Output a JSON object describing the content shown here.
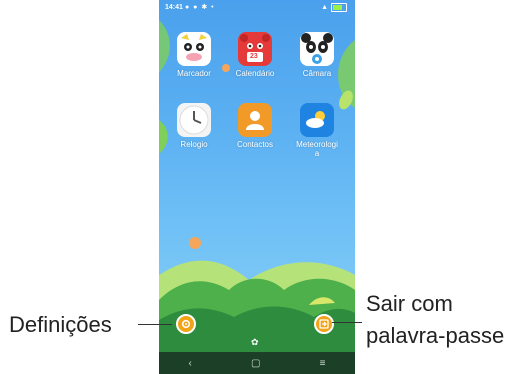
{
  "status_bar": {
    "time": "14:41"
  },
  "apps": [
    {
      "label": "Marcador",
      "icon": "cow-icon"
    },
    {
      "label": "Calendário",
      "icon": "calendar-icon",
      "badge": "23"
    },
    {
      "label": "Câmara",
      "icon": "panda-camera-icon"
    },
    {
      "label": "Relogio",
      "icon": "clock-icon"
    },
    {
      "label": "Contactos",
      "icon": "contacts-icon"
    },
    {
      "label": "Meteorologia",
      "icon": "weather-icon"
    }
  ],
  "callouts": {
    "left": "Definições",
    "right_line1": "Sair com",
    "right_line2": "palavra-passe"
  },
  "nav": {
    "back": "‹",
    "home": "▢",
    "recents": "≡"
  },
  "colors": {
    "sky": "#4aa0ec",
    "accent": "#f2a316",
    "nav": "#1c3f27"
  }
}
